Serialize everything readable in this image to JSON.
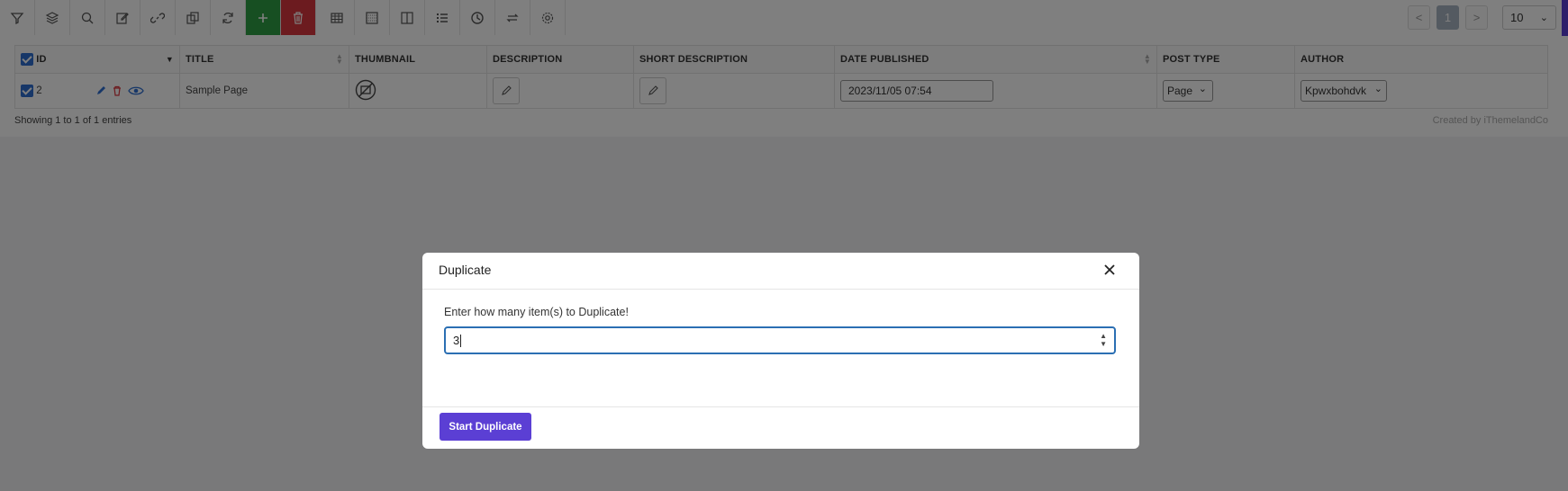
{
  "toolbar": {
    "buttons": [
      {
        "icon": "filter-icon"
      },
      {
        "icon": "layers-icon"
      },
      {
        "icon": "search-icon"
      },
      {
        "icon": "edit-icon"
      },
      {
        "icon": "link-icon"
      },
      {
        "icon": "duplicate-icon"
      },
      {
        "icon": "refresh-icon"
      },
      {
        "icon": "add-icon"
      },
      {
        "icon": "trash-icon"
      },
      {
        "icon": "table-icon"
      },
      {
        "icon": "grid-icon"
      },
      {
        "icon": "columns-icon"
      },
      {
        "icon": "list-icon"
      },
      {
        "icon": "history-icon"
      },
      {
        "icon": "swap-icon"
      },
      {
        "icon": "settings-icon"
      }
    ]
  },
  "pagination": {
    "prev": "<",
    "current": "1",
    "next": ">",
    "per_page": "10"
  },
  "table": {
    "headers": {
      "id": "ID",
      "title": "TITLE",
      "thumbnail": "THUMBNAIL",
      "description": "DESCRIPTION",
      "short_description": "SHORT DESCRIPTION",
      "date_published": "DATE PUBLISHED",
      "post_type": "POST TYPE",
      "author": "AUTHOR"
    },
    "row": {
      "id": "2",
      "title": "Sample Page",
      "date_published": "2023/11/05 07:54",
      "post_type": "Page",
      "author": "Kpwxbohdvk"
    },
    "showing": "Showing 1 to 1 of 1 entries",
    "credit": "Created by iThemelandCo"
  },
  "modal": {
    "title": "Duplicate",
    "label": "Enter how many item(s) to Duplicate!",
    "input_value": "3",
    "start_button": "Start Duplicate"
  },
  "colors": {
    "accent": "#5b3fd4",
    "add": "#2f9e44",
    "delete": "#d9363e",
    "focus": "#2b6fb3"
  }
}
